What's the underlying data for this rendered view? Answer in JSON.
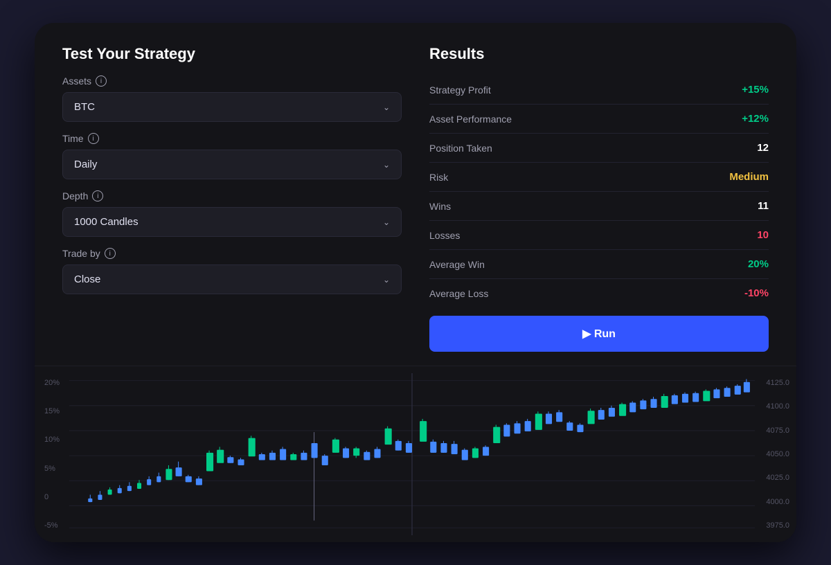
{
  "left_panel": {
    "title": "Test Your Strategy",
    "fields": [
      {
        "label": "Assets",
        "has_info": true,
        "value": "BTC"
      },
      {
        "label": "Time",
        "has_info": true,
        "value": "Daily"
      },
      {
        "label": "Depth",
        "has_info": true,
        "value": "1000 Candles"
      },
      {
        "label": "Trade by",
        "has_info": true,
        "value": "Close"
      }
    ]
  },
  "right_panel": {
    "title": "Results",
    "rows": [
      {
        "label": "Strategy Profit",
        "value": "+15%",
        "color_class": "value-green"
      },
      {
        "label": "Asset Performance",
        "value": "+12%",
        "color_class": "value-green"
      },
      {
        "label": "Position Taken",
        "value": "12",
        "color_class": "value-white"
      },
      {
        "label": "Risk",
        "value": "Medium",
        "color_class": "value-yellow"
      },
      {
        "label": "Wins",
        "value": "11",
        "color_class": "value-white"
      },
      {
        "label": "Losses",
        "value": "10",
        "color_class": "value-red"
      },
      {
        "label": "Average Win",
        "value": "20%",
        "color_class": "value-green"
      },
      {
        "label": "Average Loss",
        "value": "-10%",
        "color_class": "value-red"
      }
    ],
    "run_button": "▶ Run"
  },
  "chart": {
    "y_axis_left": [
      "20%",
      "15%",
      "10%",
      "5%",
      "0",
      "-5%"
    ],
    "y_axis_right": [
      "4125.0",
      "4100.0",
      "4075.0",
      "4050.0",
      "4025.0",
      "4000.0",
      "3975.0"
    ]
  },
  "colors": {
    "accent_blue": "#3355ff",
    "positive_green": "#00cc88",
    "negative_red": "#ff4466",
    "warning_yellow": "#f0c040",
    "candle_green": "#00cc88",
    "candle_blue": "#4488ff",
    "background": "#141418",
    "panel_bg": "#1e1e26"
  }
}
